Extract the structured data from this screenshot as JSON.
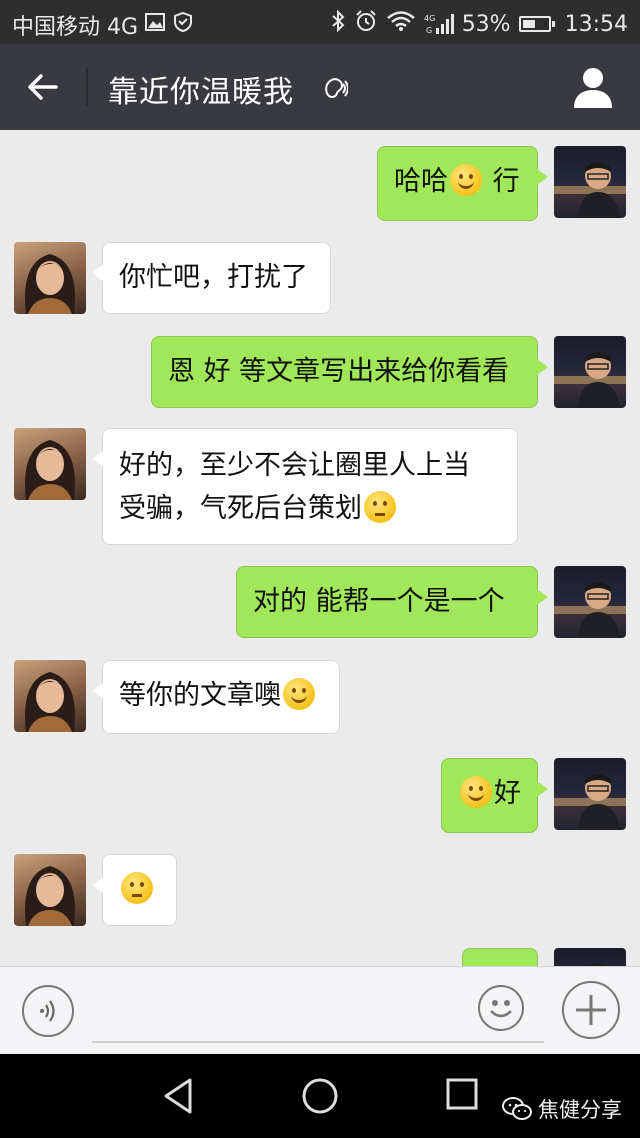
{
  "status_bar": {
    "carrier": "中国移动 4G",
    "battery": "53%",
    "time": "13:54",
    "battery_level": 0.53
  },
  "header": {
    "title": "靠近你温暖我"
  },
  "messages": [
    {
      "from": "me",
      "text": "哈哈",
      "emoji_mid": "grin",
      "text_after": " 行"
    },
    {
      "from": "her",
      "text": "你忙吧，打扰了"
    },
    {
      "from": "me",
      "text": "恩 好 等文章写出来给你看看"
    },
    {
      "from": "her",
      "line1": "好的，至少不会让圈里人上当",
      "line2": "受骗，气死后台策划",
      "emoji": "thinking"
    },
    {
      "from": "me",
      "text": "对的 能帮一个是一个"
    },
    {
      "from": "her",
      "text": "等你的文章噢",
      "emoji": "smile"
    },
    {
      "from": "me",
      "emoji": "blush",
      "text": "好"
    },
    {
      "from": "her",
      "emoji": "thinking"
    }
  ],
  "input": {
    "placeholder": ""
  },
  "watermark": {
    "text": "焦健分享"
  },
  "colors": {
    "my_bubble": "#a0e75a",
    "their_bubble": "#ffffff",
    "title_bar": "#393a3f",
    "chat_background": "#ebebeb"
  },
  "icons": [
    "back-arrow-icon",
    "voice-mode-icon",
    "profile-icon",
    "voice-input-icon",
    "emoji-icon",
    "plus-icon",
    "nav-back-icon",
    "nav-home-icon",
    "nav-recents-icon",
    "wechat-icon"
  ]
}
